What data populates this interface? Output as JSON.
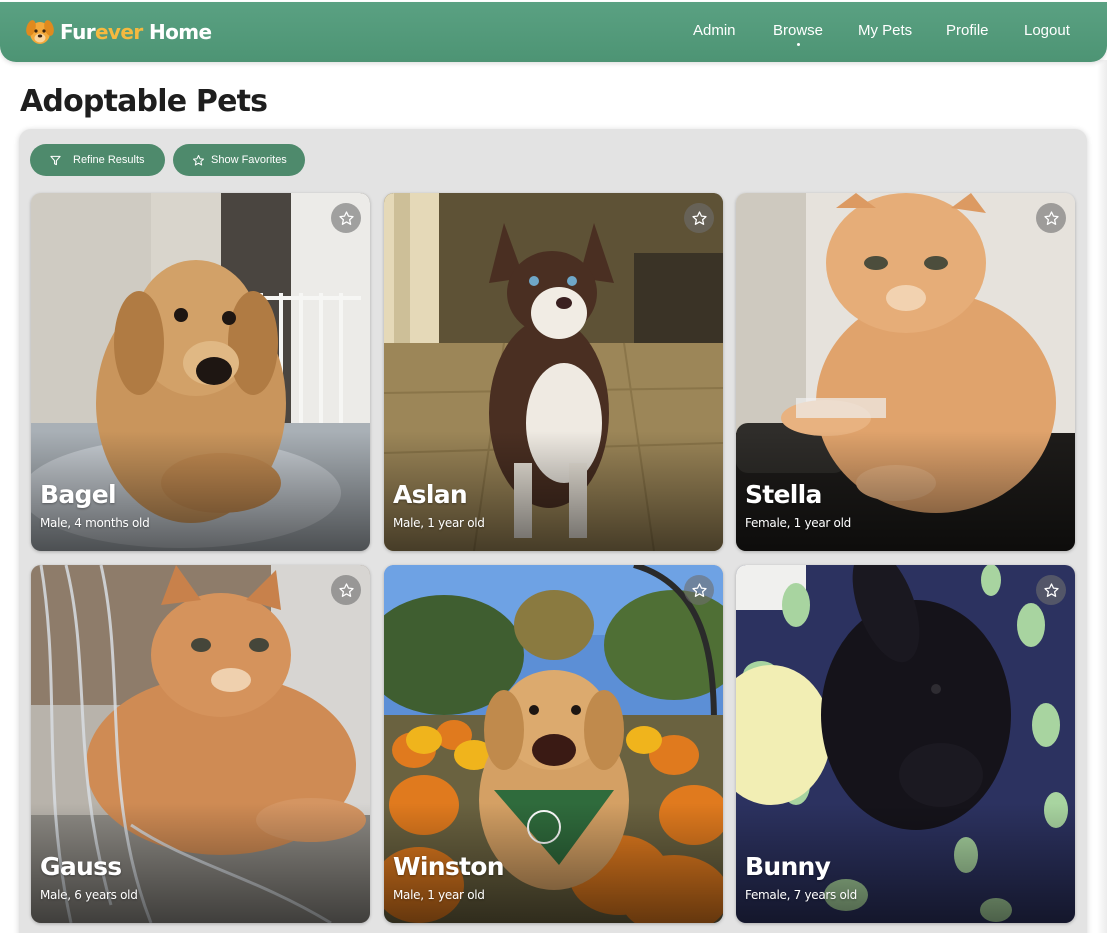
{
  "brand": {
    "part1": "Fur",
    "part2": "ever",
    "part3": " Home",
    "logo_icon": "dog-face-icon"
  },
  "nav": {
    "items": [
      {
        "label": "Admin"
      },
      {
        "label": "Browse",
        "active": true
      },
      {
        "label": "My Pets"
      },
      {
        "label": "Profile"
      },
      {
        "label": "Logout"
      }
    ]
  },
  "page": {
    "title": "Adoptable Pets"
  },
  "filters": {
    "refine_label": "Refine Results",
    "refine_icon": "filter-icon",
    "favorites_label": "Show Favorites",
    "favorites_icon": "star-outline-icon"
  },
  "pets": [
    {
      "name": "Bagel",
      "details": "Male, 4 months old",
      "photo": "golden-retriever-puppy"
    },
    {
      "name": "Aslan",
      "details": "Male, 1 year old",
      "photo": "husky"
    },
    {
      "name": "Stella",
      "details": "Female, 1 year old",
      "photo": "orange-tabby-cat"
    },
    {
      "name": "Gauss",
      "details": "Male, 6 years old",
      "photo": "orange-cat-lying"
    },
    {
      "name": "Winston",
      "details": "Male, 1 year old",
      "photo": "golden-retriever-pumpkins"
    },
    {
      "name": "Bunny",
      "details": "Female, 7 years old",
      "photo": "black-rabbit"
    }
  ],
  "colors": {
    "nav_green": "#52987a",
    "button_green": "#4e8a6c",
    "brand_accent": "#f5b93f",
    "panel_gray": "#e3e3e3"
  }
}
